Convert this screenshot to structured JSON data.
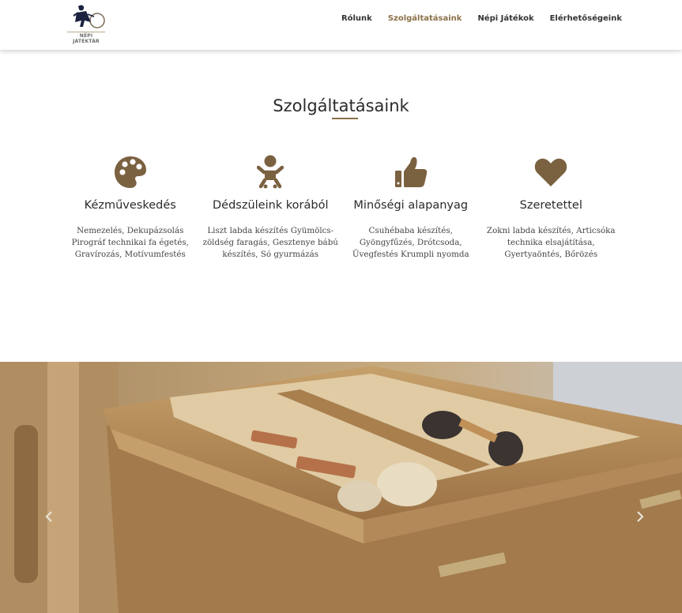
{
  "brand": {
    "logo_text": "NÉPI JÁTÉKTÁR"
  },
  "nav": {
    "items": [
      {
        "label": "Rólunk",
        "active": false
      },
      {
        "label": "Szolgáltatásaink",
        "active": true
      },
      {
        "label": "Népi Játékok",
        "active": false
      },
      {
        "label": "Elérhetőségeink",
        "active": false
      }
    ]
  },
  "section": {
    "title": "Szolgáltatásaink",
    "services": [
      {
        "icon": "palette-icon",
        "title": "Kézműveskedés",
        "description": "Nemezelés, Dekupázsolás Pirográf technikai fa égetés, Gravírozás, Motívumfestés"
      },
      {
        "icon": "baby-icon",
        "title": "Dédszüleink korából",
        "description": "Liszt labda készítés Gyümölcs-zöldség faragás, Gesztenye bábú készítés, Só gyurmázás"
      },
      {
        "icon": "thumbs-up-icon",
        "title": "Minőségi alapanyag",
        "description": "Csuhébaba készítés, Gyöngyfűzés, Drótcsoda, Üvegfestés Krumpli nyomda"
      },
      {
        "icon": "heart-icon",
        "title": "Szeretettel",
        "description": "Zokni labda készítés, Articsóka technika elsajátítása, Gyertyaöntés, Bőrözés"
      }
    ]
  },
  "colors": {
    "accent": "#8a7048",
    "icon": "#7a6140",
    "text": "#2b2b2b"
  }
}
